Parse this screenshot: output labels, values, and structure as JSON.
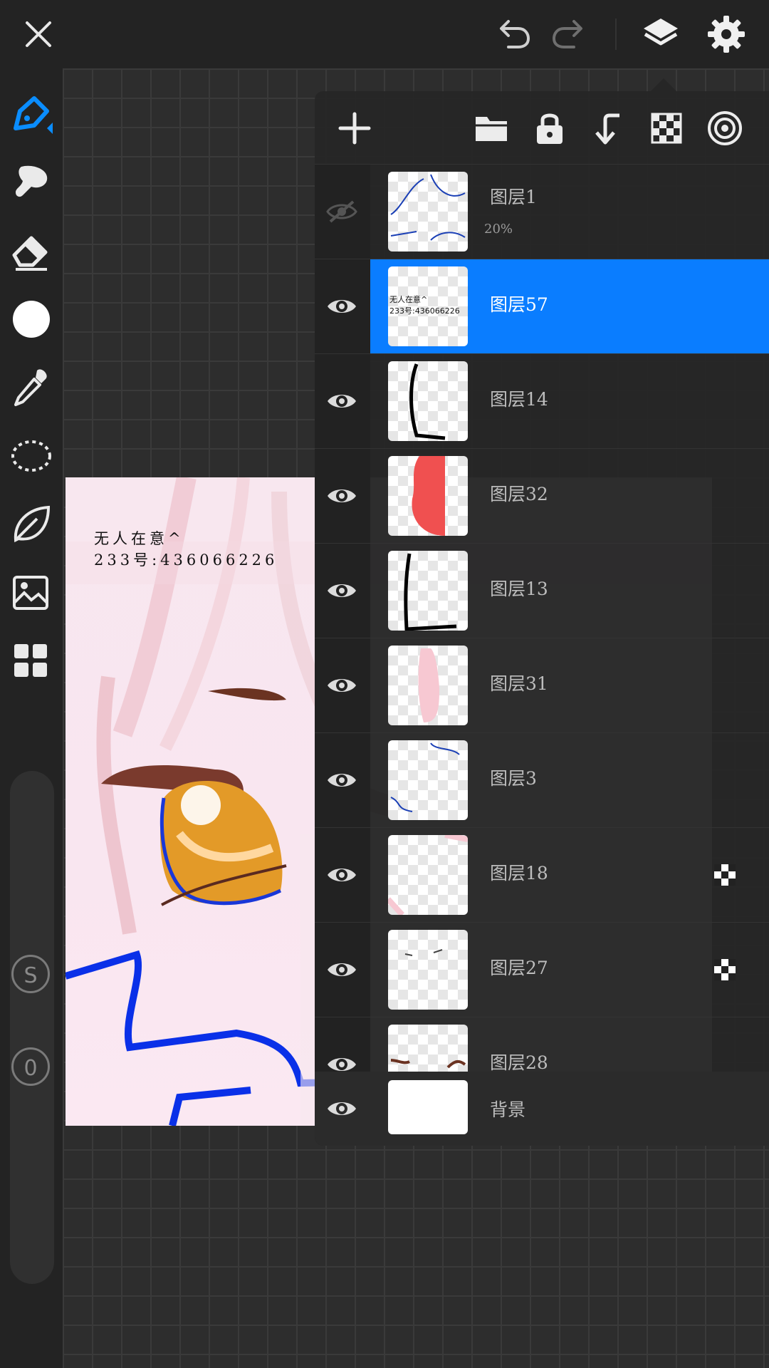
{
  "topbar": {
    "close": "close-icon",
    "undo": "undo-icon",
    "redo": "redo-icon",
    "layers": "layers-icon",
    "settings": "gear-icon"
  },
  "toolbar": {
    "tools": [
      "pen-icon",
      "smudge-icon",
      "eraser-icon",
      "color-swatch",
      "eyedropper-icon",
      "lasso-icon",
      "leaf-icon",
      "image-icon",
      "grid-icon"
    ],
    "brush_size_label": "S",
    "opacity_label": "0",
    "active_color": "#ffffff",
    "accent": "#0a7dff"
  },
  "canvas": {
    "text_line1": "无人在意^",
    "text_line2": "233号:436066226"
  },
  "layers_panel": {
    "toolbar": [
      "add-icon",
      "folder-icon",
      "lock-icon",
      "merge-down-icon",
      "alpha-lock-icon",
      "target-icon"
    ],
    "layers": [
      {
        "name": "图层1",
        "opacity": "20%",
        "visible": false,
        "selected": false,
        "alpha_lock": false
      },
      {
        "name": "图层57",
        "opacity": "",
        "visible": true,
        "selected": true,
        "alpha_lock": false
      },
      {
        "name": "图层14",
        "opacity": "",
        "visible": true,
        "selected": false,
        "alpha_lock": false
      },
      {
        "name": "图层32",
        "opacity": "",
        "visible": true,
        "selected": false,
        "alpha_lock": false
      },
      {
        "name": "图层13",
        "opacity": "",
        "visible": true,
        "selected": false,
        "alpha_lock": false
      },
      {
        "name": "图层31",
        "opacity": "",
        "visible": true,
        "selected": false,
        "alpha_lock": false
      },
      {
        "name": "图层3",
        "opacity": "",
        "visible": true,
        "selected": false,
        "alpha_lock": false
      },
      {
        "name": "图层18",
        "opacity": "",
        "visible": true,
        "selected": false,
        "alpha_lock": true
      },
      {
        "name": "图层27",
        "opacity": "",
        "visible": true,
        "selected": false,
        "alpha_lock": true
      },
      {
        "name": "图层28",
        "opacity": "",
        "visible": true,
        "selected": false,
        "alpha_lock": false
      }
    ],
    "background_layer": {
      "name": "背景",
      "visible": true
    }
  }
}
